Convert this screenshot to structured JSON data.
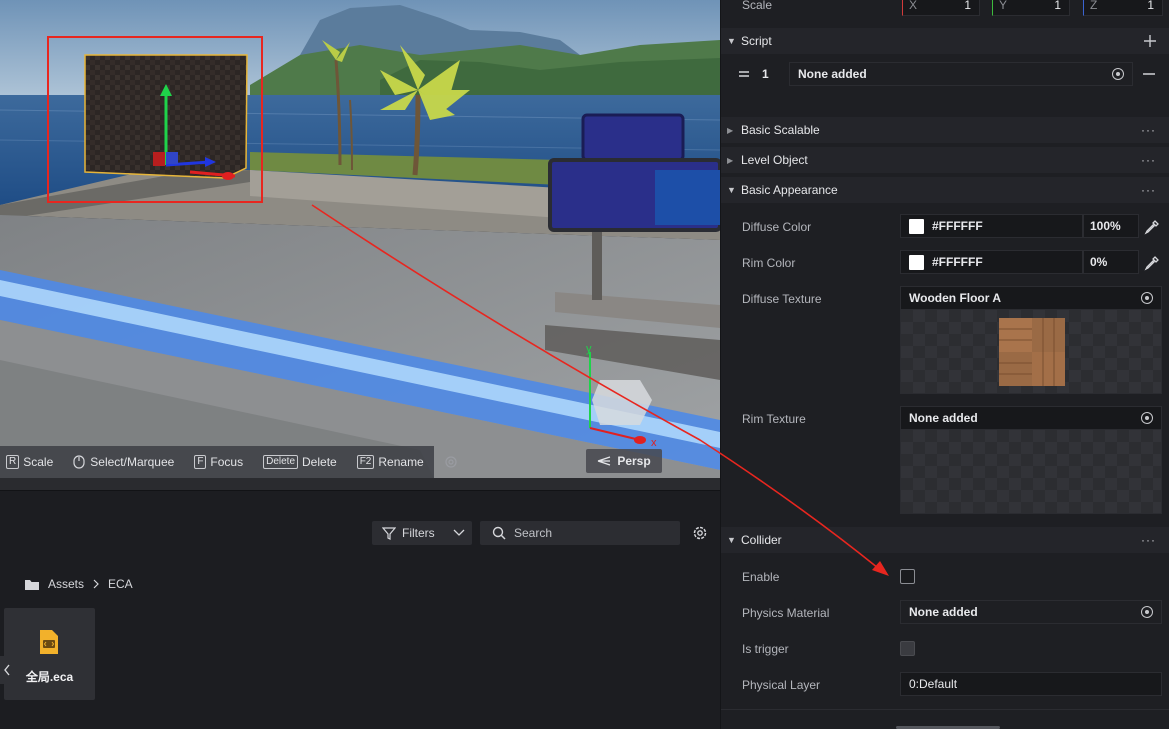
{
  "viewport": {
    "toolbar": [
      {
        "key": "R",
        "label": "Scale"
      },
      {
        "key": "",
        "label": "Select/Marquee"
      },
      {
        "key": "F",
        "label": "Focus"
      },
      {
        "key": "Delete",
        "label": "Delete"
      },
      {
        "key": "F2",
        "label": "Rename"
      }
    ],
    "persp_label": "Persp",
    "gizmo_axes": {
      "x": "x",
      "y": "y"
    }
  },
  "assets": {
    "filters_label": "Filters",
    "search_placeholder": "Search",
    "breadcrumb": [
      "Assets",
      "ECA"
    ],
    "files": [
      {
        "name": "全局.eca",
        "icon": "eca-file-icon"
      }
    ]
  },
  "inspector": {
    "scale": {
      "label": "Scale",
      "x_axis": "X",
      "x": "1",
      "y_axis": "Y",
      "y": "1",
      "z_axis": "Z",
      "z": "1"
    },
    "script": {
      "title": "Script",
      "row_index": "1",
      "value": "None added"
    },
    "sections": {
      "basic_scalable": "Basic Scalable",
      "level_object": "Level Object",
      "basic_appearance": "Basic Appearance",
      "collider": "Collider"
    },
    "appearance": {
      "diffuse_color_label": "Diffuse Color",
      "diffuse_color_hex": "#FFFFFF",
      "diffuse_color_pct": "100%",
      "rim_color_label": "Rim Color",
      "rim_color_hex": "#FFFFFF",
      "rim_color_pct": "0%",
      "diffuse_texture_label": "Diffuse Texture",
      "diffuse_texture_value": "Wooden Floor A",
      "rim_texture_label": "Rim Texture",
      "rim_texture_value": "None added"
    },
    "collider": {
      "enable_label": "Enable",
      "enable_checked": false,
      "physics_material_label": "Physics Material",
      "physics_material_value": "None added",
      "is_trigger_label": "Is trigger",
      "is_trigger_checked": false,
      "physical_layer_label": "Physical Layer",
      "physical_layer_value": "0:Default"
    }
  },
  "colors": {
    "annotation_red": "#e8261f",
    "panel_bg": "#1e1f23",
    "gizmo_green": "#1fd34a",
    "gizmo_red": "#e02020",
    "gizmo_blue": "#2036e0"
  }
}
